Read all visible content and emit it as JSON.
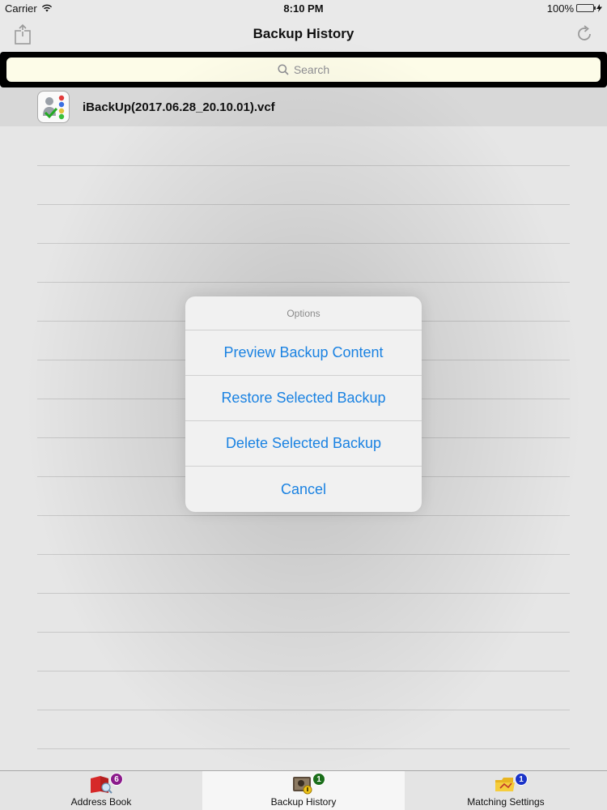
{
  "status": {
    "carrier": "Carrier",
    "time": "8:10 PM",
    "battery": "100%",
    "battery_level": 1.0
  },
  "navbar": {
    "title": "Backup History",
    "left_icon": "share-icon",
    "right_icon": "refresh-icon"
  },
  "search": {
    "placeholder": "Search"
  },
  "backups": [
    {
      "name": "iBackUp(2017.06.28_20.10.01).vcf",
      "icon": "contacts-file-icon"
    }
  ],
  "alert": {
    "title": "Options",
    "actions": [
      {
        "label": "Preview Backup Content"
      },
      {
        "label": "Restore Selected Backup"
      },
      {
        "label": "Delete Selected Backup"
      },
      {
        "label": "Cancel"
      }
    ],
    "action_color": "#1a82e2"
  },
  "tabbar": {
    "tabs": [
      {
        "label": "Address Book",
        "badge": "6",
        "badge_color": "#8b1a8b",
        "icon": "address-book-icon",
        "active": false
      },
      {
        "label": "Backup History",
        "badge": "1",
        "badge_color": "#1a6e1a",
        "icon": "backup-history-icon",
        "active": true
      },
      {
        "label": "Matching Settings",
        "badge": "1",
        "badge_color": "#1a33c8",
        "icon": "matching-settings-icon",
        "active": false
      }
    ]
  }
}
